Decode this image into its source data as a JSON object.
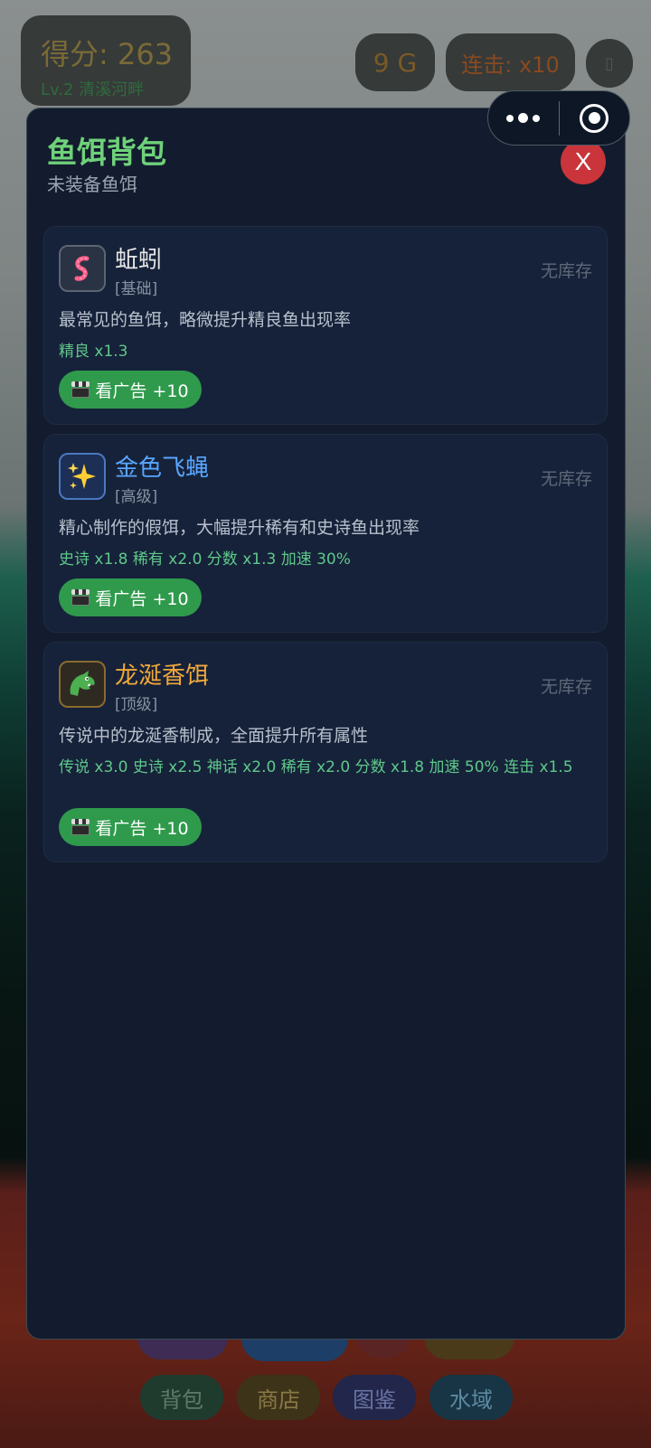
{
  "hud": {
    "score": "得分: 263",
    "level": "Lv.2 清溪河畔",
    "gold": "9 G",
    "combo": "连击: x10",
    "menu": "▯"
  },
  "bottom_nav": {
    "bag": "背包",
    "shop": "商店",
    "guide": "图鉴",
    "waters": "水域"
  },
  "modal": {
    "title": "鱼饵背包",
    "subtitle": "未装备鱼饵",
    "close": "X",
    "baits": [
      {
        "icon": "worm-icon",
        "name": "蚯蚓",
        "name_color": "#e6e6e6",
        "tier": "[基础]",
        "stock": "无库存",
        "desc": "最常见的鱼饵，略微提升精良鱼出现率",
        "stats": "精良 x1.3",
        "ad": "看广告 +10"
      },
      {
        "icon": "sparkles-icon",
        "name": "金色飞蝇",
        "name_color": "#58a6ff",
        "tier": "[高级]",
        "stock": "无库存",
        "desc": "精心制作的假饵，大幅提升稀有和史诗鱼出现率",
        "stats": "史诗 x1.8  稀有 x2.0  分数 x1.3  加速 30%",
        "ad": "看广告 +10"
      },
      {
        "icon": "dragon-icon",
        "name": "龙涎香饵",
        "name_color": "#f0a83a",
        "tier": "[顶级]",
        "stock": "无库存",
        "desc": "传说中的龙涎香制成，全面提升所有属性",
        "stats": "传说 x3.0  史诗 x2.5  神话 x2.0  稀有 x2.0  分数 x1.8  加速 50%  连击 x1.5",
        "ad": "看广告 +10"
      }
    ]
  }
}
